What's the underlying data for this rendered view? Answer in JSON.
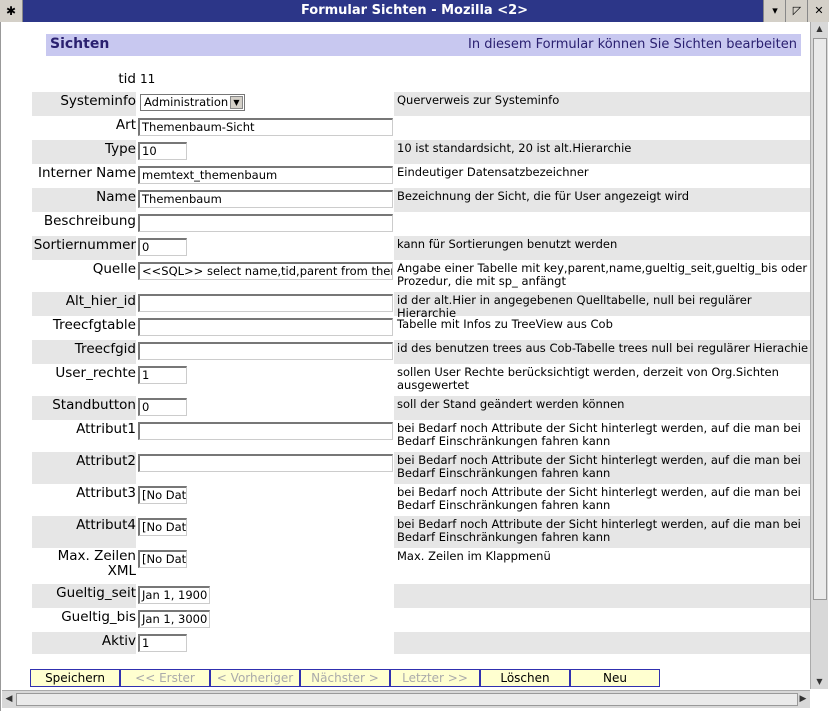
{
  "window": {
    "title": "Formular Sichten - Mozilla <2>"
  },
  "header": {
    "left": "Sichten",
    "right": "In diesem Formular können Sie Sichten bearbeiten"
  },
  "fields": [
    {
      "label": "tid",
      "value": "11",
      "kind": "plain",
      "desc": "",
      "shade": false
    },
    {
      "label": "Systeminfo",
      "value": "Administration",
      "kind": "select",
      "desc": "Querverweis zur Systeminfo",
      "shade": true
    },
    {
      "label": "Art",
      "value": "Themenbaum-Sicht",
      "kind": "long",
      "desc": "",
      "shade": false
    },
    {
      "label": "Type",
      "value": "10",
      "kind": "short",
      "desc": "10 ist standardsicht, 20 ist alt.Hierarchie",
      "shade": true
    },
    {
      "label": "Interner Name",
      "value": "memtext_themenbaum",
      "kind": "long",
      "desc": "Eindeutiger Datensatzbezeichner",
      "shade": false
    },
    {
      "label": "Name",
      "value": "Themenbaum",
      "kind": "long",
      "desc": "Bezeichnung der Sicht, die für User angezeigt wird",
      "shade": true
    },
    {
      "label": "Beschreibung",
      "value": "",
      "kind": "long",
      "desc": "",
      "shade": false
    },
    {
      "label": "Sortiernummer",
      "value": "0",
      "kind": "short",
      "desc": "kann für Sortierungen benutzt werden",
      "shade": true
    },
    {
      "label": "Quelle",
      "value": "<<SQL>> select name,tid,parent from themen",
      "kind": "long",
      "desc": "Angabe einer Tabelle mit key,parent,name,gueltig_seit,gueltig_bis oder Prozedur, die mit sp_ anfängt",
      "shade": false
    },
    {
      "label": "Alt_hier_id",
      "value": "",
      "kind": "long",
      "desc": "id der alt.Hier in angegebenen Quelltabelle, null bei regulärer Hierarchie",
      "shade": true
    },
    {
      "label": "Treecfgtable",
      "value": "",
      "kind": "long",
      "desc": "Tabelle mit Infos zu TreeView aus Cob",
      "shade": false
    },
    {
      "label": "Treecfgid",
      "value": "",
      "kind": "long",
      "desc": "id des benutzen trees aus Cob-Tabelle trees null bei regulärer Hierachie",
      "shade": true
    },
    {
      "label": "User_rechte",
      "value": "1",
      "kind": "short",
      "desc": "sollen User Rechte berücksichtigt werden, derzeit von Org.Sichten ausgewertet",
      "shade": false
    },
    {
      "label": "Standbutton",
      "value": "0",
      "kind": "short",
      "desc": "soll der Stand geändert werden können",
      "shade": true
    },
    {
      "label": "Attribut1",
      "value": "",
      "kind": "long",
      "desc": "bei Bedarf noch Attribute der Sicht hinterlegt werden, auf die man bei Bedarf Einschränkungen fahren kann",
      "shade": false
    },
    {
      "label": "Attribut2",
      "value": "",
      "kind": "long",
      "desc": "bei Bedarf noch Attribute der Sicht hinterlegt werden, auf die man bei Bedarf Einschränkungen fahren kann",
      "shade": true
    },
    {
      "label": "Attribut3",
      "value": "[No Data]",
      "kind": "short",
      "desc": "bei Bedarf noch Attribute der Sicht hinterlegt werden, auf die man bei Bedarf Einschränkungen fahren kann",
      "shade": false
    },
    {
      "label": "Attribut4",
      "value": "[No Data]",
      "kind": "short",
      "desc": "bei Bedarf noch Attribute der Sicht hinterlegt werden, auf die man bei Bedarf Einschränkungen fahren kann",
      "shade": true
    },
    {
      "label": "Max. Zeilen XML",
      "value": "[No Data]",
      "kind": "short",
      "desc": "Max. Zeilen im Klappmenü",
      "shade": false
    },
    {
      "label": "Gueltig_seit",
      "value": "Jan 1, 1900",
      "kind": "date",
      "desc": "",
      "shade": true
    },
    {
      "label": "Gueltig_bis",
      "value": "Jan 1, 3000",
      "kind": "date",
      "desc": "",
      "shade": false
    },
    {
      "label": "Aktiv",
      "value": "1",
      "kind": "short",
      "desc": "",
      "shade": true
    }
  ],
  "buttons": [
    {
      "label": "Speichern",
      "enabled": true
    },
    {
      "label": "<< Erster",
      "enabled": false
    },
    {
      "label": "< Vorheriger",
      "enabled": false
    },
    {
      "label": "Nächster >",
      "enabled": false
    },
    {
      "label": "Letzter >>",
      "enabled": false
    },
    {
      "label": "Löschen",
      "enabled": true
    },
    {
      "label": "Neu",
      "enabled": true
    }
  ]
}
